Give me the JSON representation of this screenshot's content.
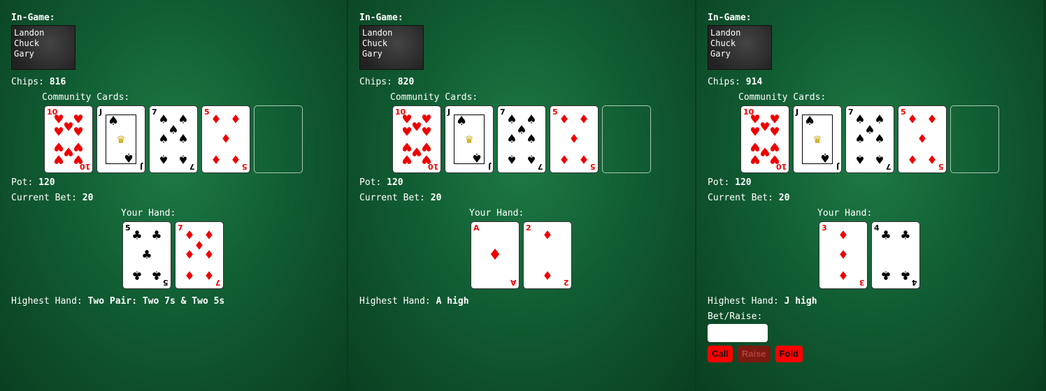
{
  "panels": [
    {
      "in_game_label": "In-Game:",
      "players": [
        "Landon",
        "Chuck",
        "Gary"
      ],
      "chips_label": "Chips:",
      "chips": "816",
      "community_label": "Community Cards:",
      "community": [
        {
          "rank": "10",
          "suit": "♥",
          "color": "red"
        },
        {
          "rank": "J",
          "suit": "♠",
          "color": "blk"
        },
        {
          "rank": "7",
          "suit": "♠",
          "color": "blk"
        },
        {
          "rank": "5",
          "suit": "♦",
          "color": "red"
        },
        {
          "rank": "",
          "suit": "",
          "color": "empty"
        }
      ],
      "pot_label": "Pot:",
      "pot": "120",
      "current_bet_label": "Current Bet:",
      "current_bet": "20",
      "hand_label": "Your Hand:",
      "hand": [
        {
          "rank": "5",
          "suit": "♣",
          "color": "blk"
        },
        {
          "rank": "7",
          "suit": "♦",
          "color": "red"
        }
      ],
      "highest_label": "Highest Hand:",
      "highest": "Two Pair: Two 7s & Two 5s"
    },
    {
      "in_game_label": "In-Game:",
      "players": [
        "Landon",
        "Chuck",
        "Gary"
      ],
      "chips_label": "Chips:",
      "chips": "820",
      "community_label": "Community Cards:",
      "community": [
        {
          "rank": "10",
          "suit": "♥",
          "color": "red"
        },
        {
          "rank": "J",
          "suit": "♠",
          "color": "blk"
        },
        {
          "rank": "7",
          "suit": "♠",
          "color": "blk"
        },
        {
          "rank": "5",
          "suit": "♦",
          "color": "red"
        },
        {
          "rank": "",
          "suit": "",
          "color": "empty"
        }
      ],
      "pot_label": "Pot:",
      "pot": "120",
      "current_bet_label": "Current Bet:",
      "current_bet": "20",
      "hand_label": "Your Hand:",
      "hand": [
        {
          "rank": "A",
          "suit": "♦",
          "color": "red"
        },
        {
          "rank": "2",
          "suit": "♦",
          "color": "red"
        }
      ],
      "highest_label": "Highest Hand:",
      "highest": "A high"
    },
    {
      "in_game_label": "In-Game:",
      "players": [
        "Landon",
        "Chuck",
        "Gary"
      ],
      "chips_label": "Chips:",
      "chips": "914",
      "community_label": "Community Cards:",
      "community": [
        {
          "rank": "10",
          "suit": "♥",
          "color": "red"
        },
        {
          "rank": "J",
          "suit": "♠",
          "color": "blk"
        },
        {
          "rank": "7",
          "suit": "♠",
          "color": "blk"
        },
        {
          "rank": "5",
          "suit": "♦",
          "color": "red"
        },
        {
          "rank": "",
          "suit": "",
          "color": "empty"
        }
      ],
      "pot_label": "Pot:",
      "pot": "120",
      "current_bet_label": "Current Bet:",
      "current_bet": "20",
      "hand_label": "Your Hand:",
      "hand": [
        {
          "rank": "3",
          "suit": "♦",
          "color": "red"
        },
        {
          "rank": "4",
          "suit": "♣",
          "color": "blk"
        }
      ],
      "highest_label": "Highest Hand:",
      "highest": "J high",
      "bet_raise_label": "Bet/Raise:",
      "bet_input_value": "",
      "buttons": {
        "call": "Call",
        "raise": "Raise",
        "fold": "Fold"
      }
    }
  ]
}
